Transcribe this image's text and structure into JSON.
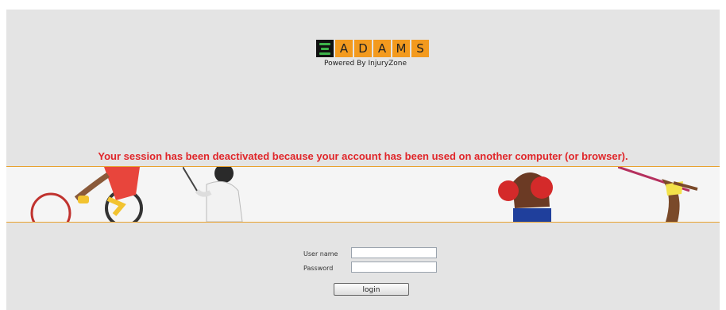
{
  "logo": {
    "letters": [
      "A",
      "D",
      "A",
      "M",
      "S"
    ],
    "tagline": "Powered By InjuryZone",
    "colors": {
      "accent": "#f39a1e",
      "mark": "#3db34a"
    }
  },
  "message": "Your session has been deactivated because your account has been used on another computer (or browser).",
  "colors": {
    "message": "#e0262a",
    "banner_line": "#e8a12e",
    "background": "#e4e4e4"
  },
  "form": {
    "username_label": "User name",
    "password_label": "Password",
    "username_value": "",
    "password_value": "",
    "login_label": "login"
  },
  "banner": {
    "athletes": [
      "wheelchair-racer",
      "fencer",
      "boxer",
      "high-jumper"
    ]
  }
}
